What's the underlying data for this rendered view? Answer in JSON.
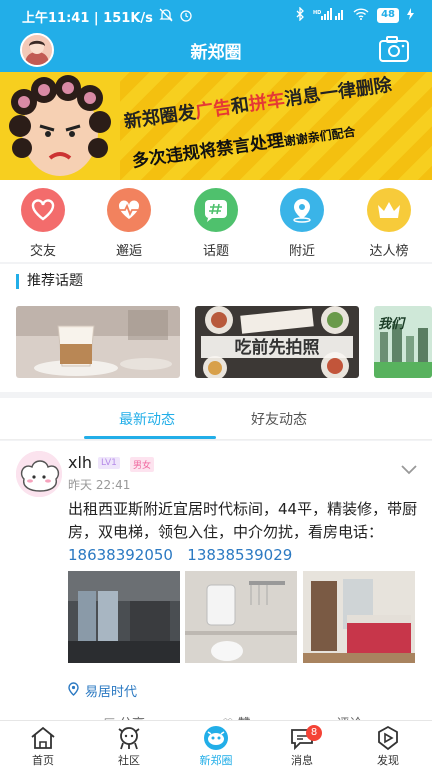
{
  "status_bar": {
    "time_speed": "上午11:41 | 151K/s",
    "signal": "HD",
    "battery": "48"
  },
  "header": {
    "title": "新郑圈"
  },
  "banner": {
    "line1_a": "新郑圈发",
    "line1_b": "广告",
    "line1_c": "和",
    "line1_d": "拼车",
    "line1_e": "消息一律删除",
    "line2_a": "多次违规将禁言处理",
    "line2_b": "谢谢亲们配合"
  },
  "quick_menu": [
    {
      "label": "交友",
      "icon": "heart-icon",
      "color": "#f36c6c"
    },
    {
      "label": "邂逅",
      "icon": "pulse-icon",
      "color": "#f2825e"
    },
    {
      "label": "话题",
      "icon": "hashtag-icon",
      "color": "#4fc16d"
    },
    {
      "label": "附近",
      "icon": "location-pin-icon",
      "color": "#3ab4e8"
    },
    {
      "label": "达人榜",
      "icon": "crown-icon",
      "color": "#f7cb3a"
    }
  ],
  "topics": {
    "title": "推荐话题",
    "card2_text": "吃前先拍照",
    "card3_text": "我们"
  },
  "tabs": [
    {
      "label": "最新动态"
    },
    {
      "label": "好友动态"
    }
  ],
  "post": {
    "name": "xlh",
    "level": "LV1",
    "gender": "男女",
    "time": "昨天 22:41",
    "text_main": "出租西亚斯附近宜居时代标间，44平，精装修，带厨房，双电梯，领包入住，中介勿扰，看房电话：",
    "phone1": "18638392050",
    "phone2": "13838539029",
    "location": "易居时代",
    "action_share": "分享",
    "action_like": "赞",
    "action_comment": "评论"
  },
  "bottom_nav": [
    {
      "label": "首页",
      "icon": "home-icon"
    },
    {
      "label": "社区",
      "icon": "community-icon"
    },
    {
      "label": "新郑圈",
      "icon": "circle-face-icon"
    },
    {
      "label": "消息",
      "icon": "message-icon",
      "badge": "8"
    },
    {
      "label": "发现",
      "icon": "compass-icon"
    }
  ]
}
